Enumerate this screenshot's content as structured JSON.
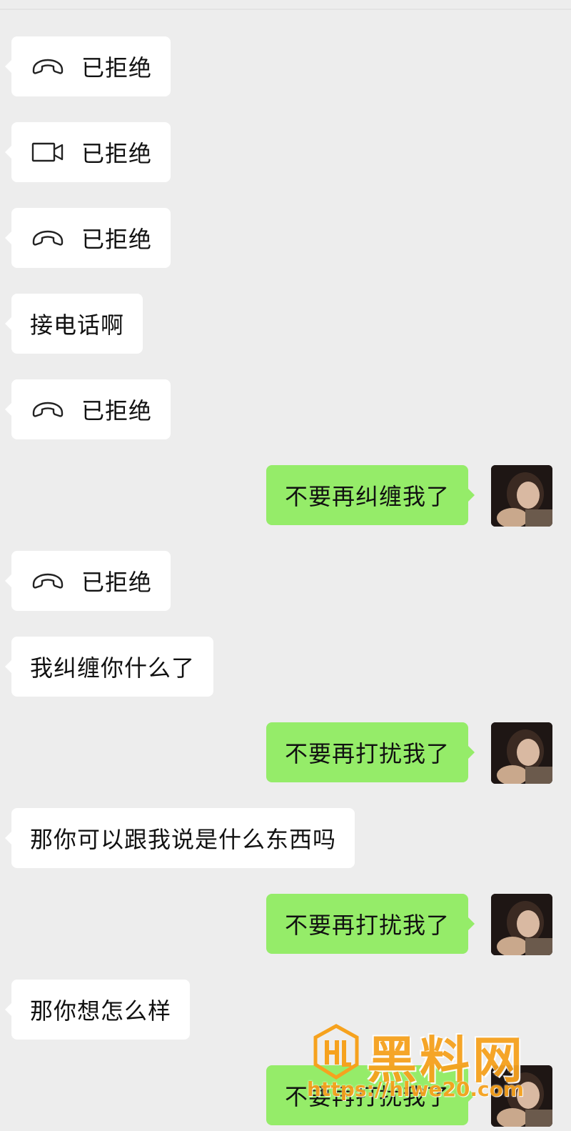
{
  "messages": [
    {
      "side": "in",
      "kind": "call",
      "icon": "phone-hangup-icon",
      "text": "已拒绝"
    },
    {
      "side": "in",
      "kind": "call",
      "icon": "video-camera-icon",
      "text": "已拒绝"
    },
    {
      "side": "in",
      "kind": "call",
      "icon": "phone-hangup-icon",
      "text": "已拒绝"
    },
    {
      "side": "in",
      "kind": "text",
      "text": "接电话啊"
    },
    {
      "side": "in",
      "kind": "call",
      "icon": "phone-hangup-icon",
      "text": "已拒绝"
    },
    {
      "side": "out",
      "kind": "text",
      "text": "不要再纠缠我了"
    },
    {
      "side": "in",
      "kind": "call",
      "icon": "phone-hangup-icon",
      "text": "已拒绝"
    },
    {
      "side": "in",
      "kind": "text",
      "text": "我纠缠你什么了"
    },
    {
      "side": "out",
      "kind": "text",
      "text": "不要再打扰我了"
    },
    {
      "side": "in",
      "kind": "text",
      "text": "那你可以跟我说是什么东西吗"
    },
    {
      "side": "out",
      "kind": "text",
      "text": "不要再打扰我了"
    },
    {
      "side": "in",
      "kind": "text",
      "text": "那你想怎么样"
    },
    {
      "side": "out",
      "kind": "text",
      "text": "不要再打扰我了"
    }
  ],
  "colors": {
    "background": "#ededed",
    "incoming_bubble": "#ffffff",
    "outgoing_bubble": "#95ec69",
    "watermark": "#f6a21e"
  },
  "watermark": {
    "title": "黑料网",
    "url": "https://hlwe20.com",
    "logo_icon": "hl-shield-logo"
  }
}
